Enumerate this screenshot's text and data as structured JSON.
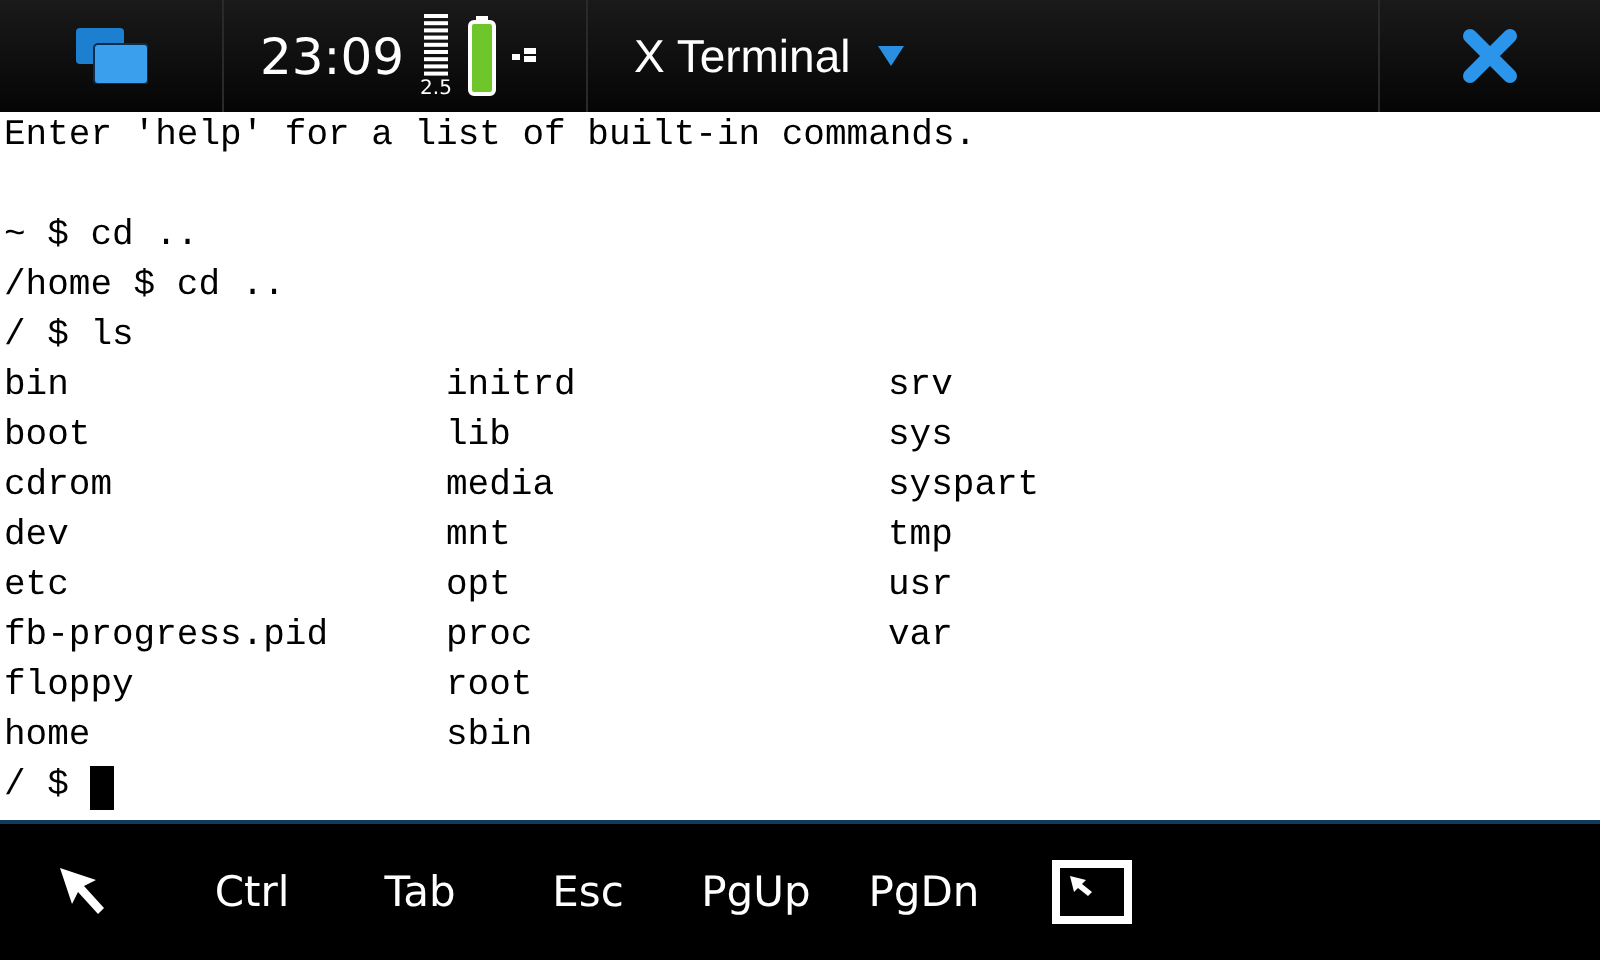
{
  "status_bar": {
    "time": "23:09",
    "network_label": "2.5",
    "app_title": "X Terminal"
  },
  "terminal": {
    "lines": [
      {
        "kind": "text",
        "text": "Enter 'help' for a list of built-in commands."
      },
      {
        "kind": "blank"
      },
      {
        "kind": "text",
        "text": "~ $ cd .."
      },
      {
        "kind": "text",
        "text": "/home $ cd .."
      },
      {
        "kind": "text",
        "text": "/ $ ls"
      },
      {
        "kind": "listing",
        "columns": [
          [
            "bin",
            "boot",
            "cdrom",
            "dev",
            "etc",
            "fb-progress.pid",
            "floppy",
            "home"
          ],
          [
            "initrd",
            "lib",
            "media",
            "mnt",
            "opt",
            "proc",
            "root",
            "sbin"
          ],
          [
            "srv",
            "sys",
            "syspart",
            "tmp",
            "usr",
            "var"
          ]
        ]
      },
      {
        "kind": "prompt",
        "text": "/ $",
        "cursor": true
      }
    ]
  },
  "toolbar": {
    "keys": [
      "Ctrl",
      "Tab",
      "Esc",
      "PgUp",
      "PgDn"
    ]
  }
}
